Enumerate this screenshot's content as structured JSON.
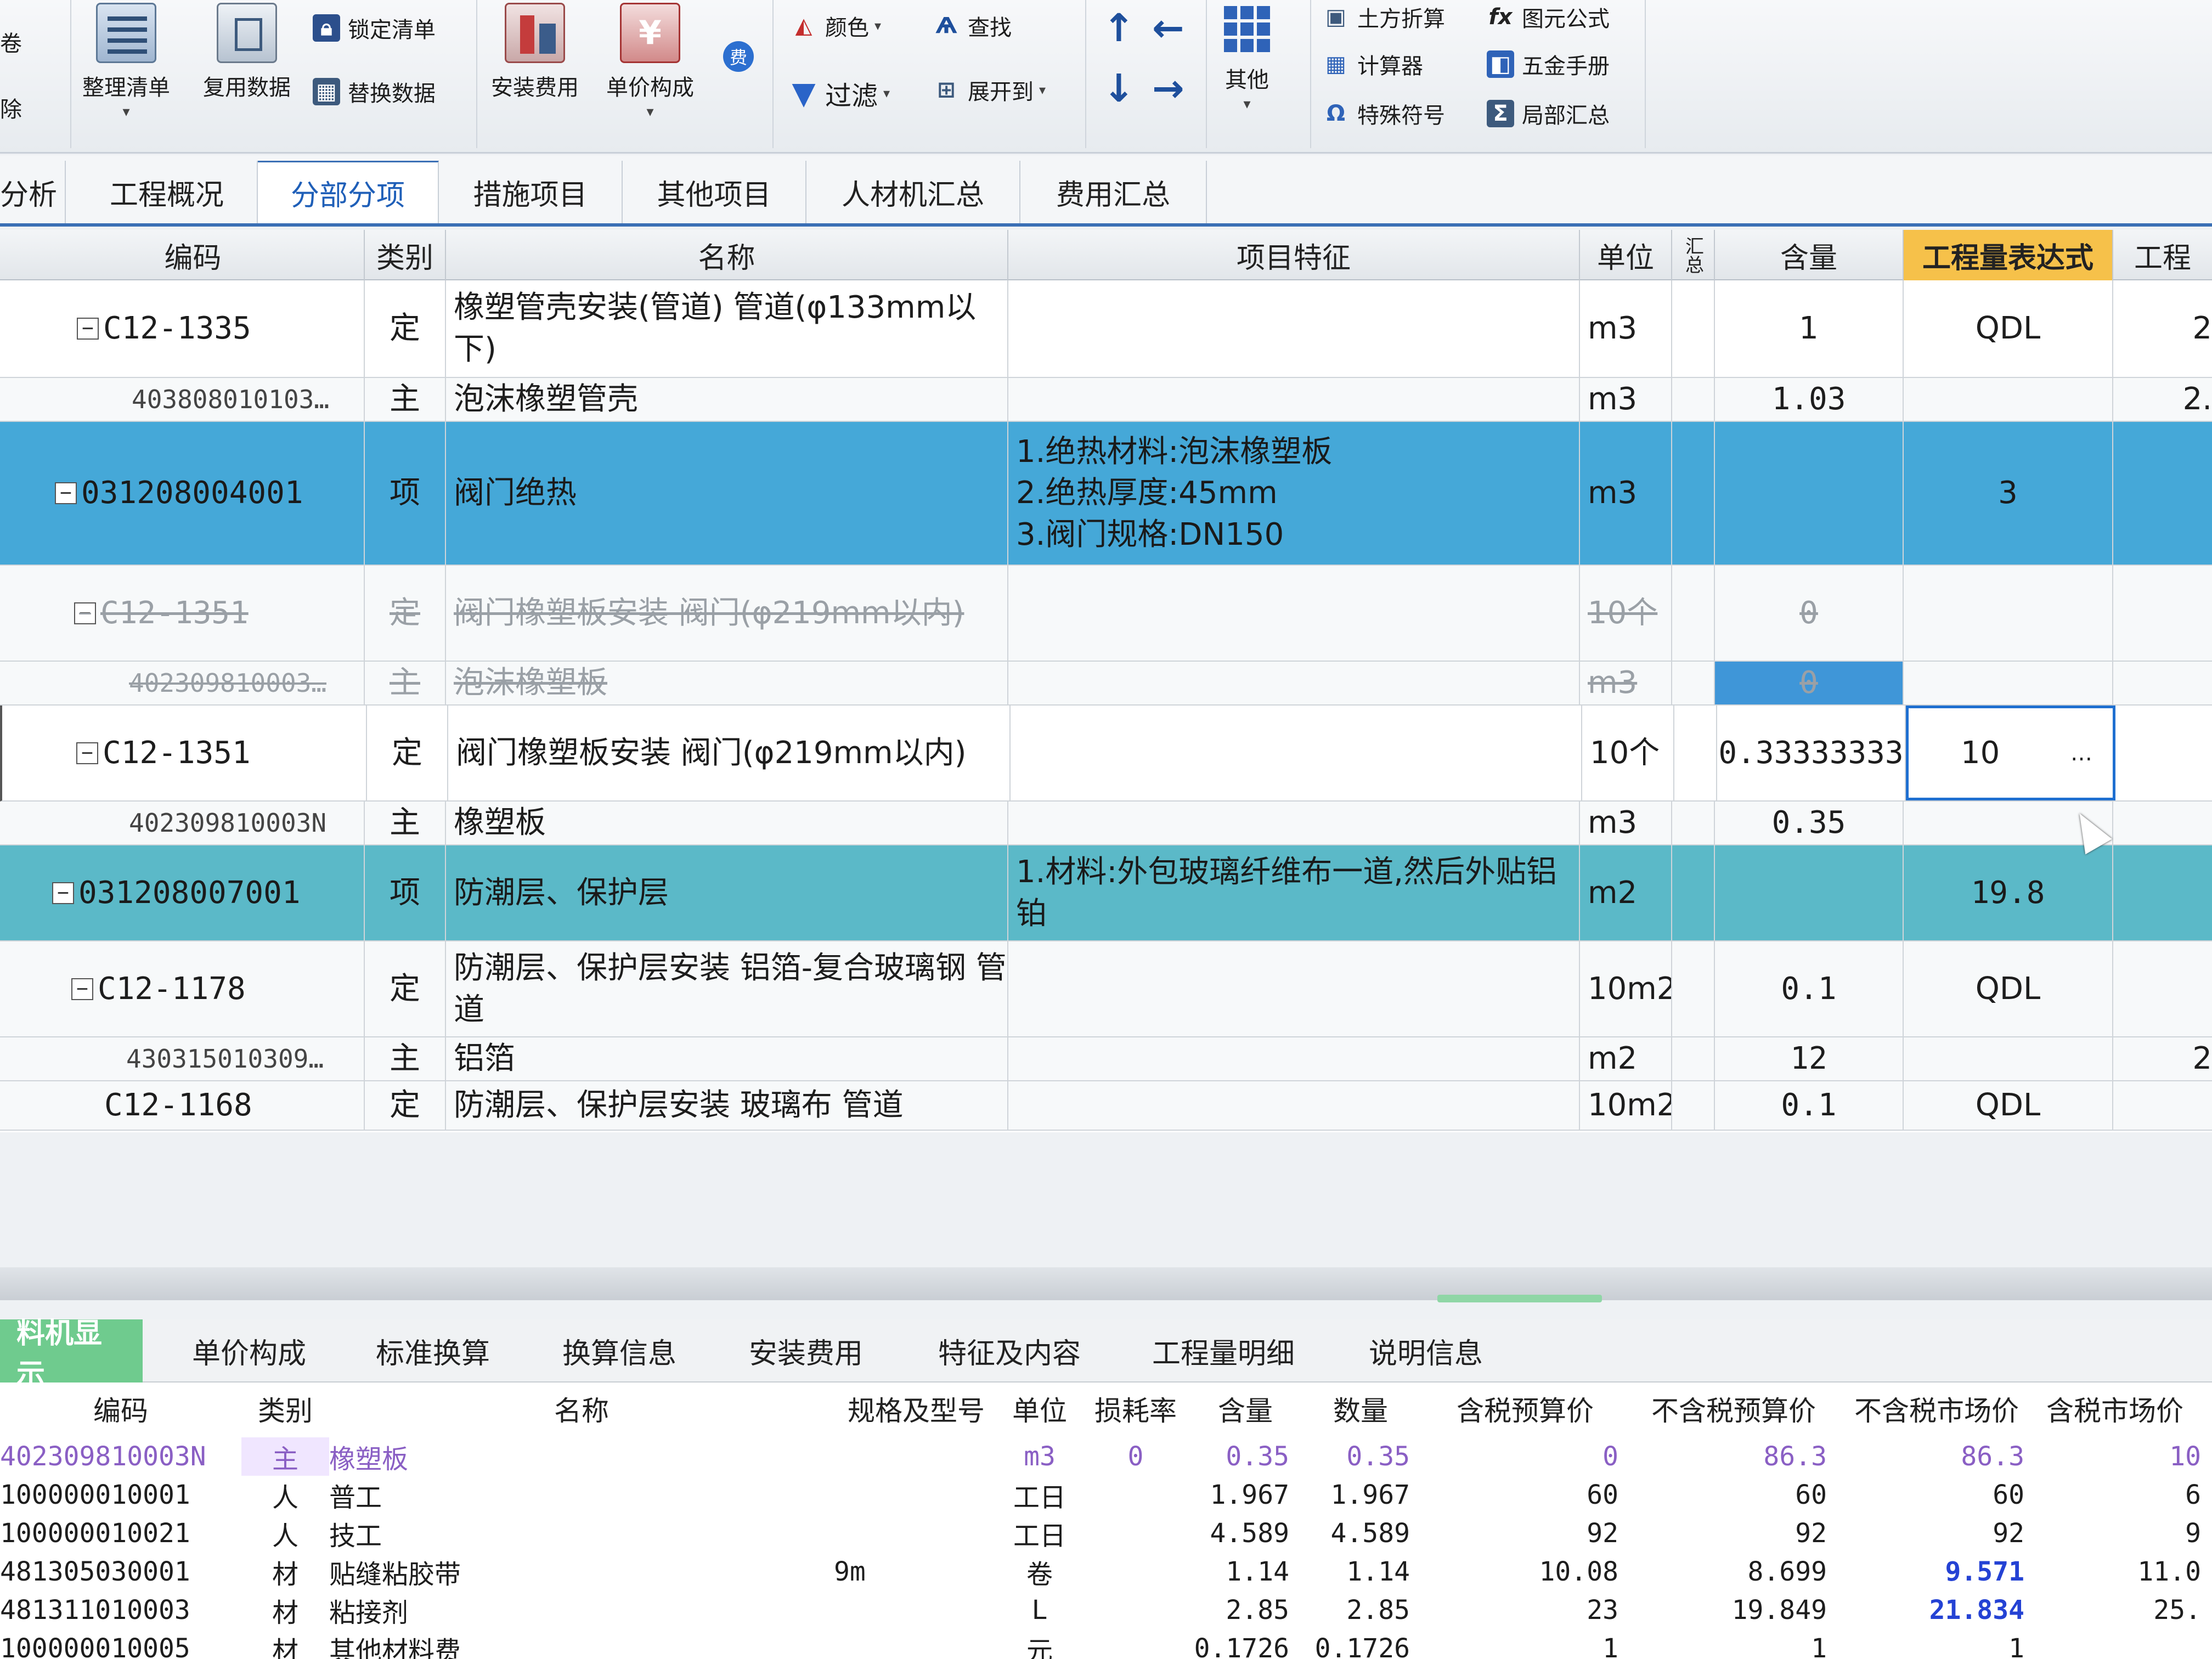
{
  "ribbon": {
    "left_cut": [
      "卷",
      "除"
    ],
    "big": [
      {
        "label": "整理清单",
        "icon": "list-organize-icon"
      },
      {
        "label": "复用数据",
        "icon": "reuse-data-icon"
      },
      {
        "label": "安装费用",
        "icon": "install-cost-icon"
      },
      {
        "label": "单价构成",
        "icon": "unit-price-icon"
      },
      {
        "label": "其他",
        "icon": "grid-more-icon"
      }
    ],
    "small": {
      "lock": "锁定清单",
      "replace": "替换数据",
      "color": "颜色",
      "find": "查找",
      "filter": "过滤",
      "expand": "展开到",
      "earthwork": "土方折算",
      "calculator": "计算器",
      "special": "特殊符号",
      "formula": "图元公式",
      "hardware": "五金手册",
      "partial": "局部汇总"
    },
    "fee_badge": "费"
  },
  "tabs": [
    "分析",
    "工程概况",
    "分部分项",
    "措施项目",
    "其他项目",
    "人材机汇总",
    "费用汇总"
  ],
  "active_tab": "分部分项",
  "grid": {
    "headers": [
      "编码",
      "类别",
      "名称",
      "项目特征",
      "单位",
      "汇总",
      "含量",
      "工程量表达式",
      "工程"
    ],
    "rows": [
      {
        "code": "C12-1335",
        "type": "定",
        "name": "橡塑管壳安装(管道) 管道(φ133mm以下)",
        "feature": "",
        "unit": "m3",
        "content": "1",
        "expr": "QDL",
        "extra": "2"
      },
      {
        "code": "403808010103…",
        "type": "主",
        "name": "泡沫橡塑管壳",
        "feature": "",
        "unit": "m3",
        "content": "1.03",
        "expr": "",
        "extra": "2."
      },
      {
        "code": "031208004001",
        "type": "项",
        "name": "阀门绝热",
        "feature": "1.绝热材料:泡沫橡塑板\n2.绝热厚度:45mm\n3.阀门规格:DN150",
        "unit": "m3",
        "content": "",
        "expr": "3",
        "extra": ""
      },
      {
        "code": "C12-1351",
        "type": "定",
        "name": "阀门橡塑板安装 阀门(φ219mm以内)",
        "feature": "",
        "unit": "10个",
        "content": "0",
        "expr": "",
        "extra": ""
      },
      {
        "code": "402309810003…",
        "type": "主",
        "name": "泡沫橡塑板",
        "feature": "",
        "unit": "m3",
        "content": "0",
        "expr": "",
        "extra": ""
      },
      {
        "code": "C12-1351",
        "type": "定",
        "name": "阀门橡塑板安装 阀门(φ219mm以内)",
        "feature": "",
        "unit": "10个",
        "content": "0.33333333",
        "expr": "10",
        "extra": ""
      },
      {
        "code": "402309810003N",
        "type": "主",
        "name": "橡塑板",
        "feature": "",
        "unit": "m3",
        "content": "0.35",
        "expr": "",
        "extra": ""
      },
      {
        "code": "031208007001",
        "type": "项",
        "name": "防潮层、保护层",
        "feature": "1.材料:外包玻璃纤维布一道,然后外贴铝铂",
        "unit": "m2",
        "content": "",
        "expr": "19.8",
        "extra": ""
      },
      {
        "code": "C12-1178",
        "type": "定",
        "name": "防潮层、保护层安装 铝箔-复合玻璃钢 管道",
        "feature": "",
        "unit": "10m2",
        "content": "0.1",
        "expr": "QDL",
        "extra": ""
      },
      {
        "code": "430315010309…",
        "type": "主",
        "name": "铝箔",
        "feature": "",
        "unit": "m2",
        "content": "12",
        "expr": "",
        "extra": "2"
      },
      {
        "code": "C12-1168",
        "type": "定",
        "name": "防潮层、保护层安装 玻璃布 管道",
        "feature": "",
        "unit": "10m2",
        "content": "0.1",
        "expr": "QDL",
        "extra": ""
      }
    ],
    "ellipsis": "…"
  },
  "bottom": {
    "tabs": [
      "料机显示",
      "单价构成",
      "标准换算",
      "换算信息",
      "安装费用",
      "特征及内容",
      "工程量明细",
      "说明信息"
    ],
    "headers": [
      "编码",
      "类别",
      "名称",
      "规格及型号",
      "单位",
      "损耗率",
      "含量",
      "数量",
      "含税预算价",
      "不含税预算价",
      "不含税市场价",
      "含税市场价"
    ],
    "rows": [
      {
        "code": "402309810003N",
        "type": "主",
        "name": "橡塑板",
        "spec": "",
        "unit": "m3",
        "loss": "0",
        "content": "0.35",
        "qty": "0.35",
        "tax_budget": "0",
        "notax_budget": "86.3",
        "notax_market": "86.3",
        "tax_market": "10"
      },
      {
        "code": "100000010001",
        "type": "人",
        "name": "普工",
        "spec": "",
        "unit": "工日",
        "loss": "",
        "content": "1.967",
        "qty": "1.967",
        "tax_budget": "60",
        "notax_budget": "60",
        "notax_market": "60",
        "tax_market": "6"
      },
      {
        "code": "100000010021",
        "type": "人",
        "name": "技工",
        "spec": "",
        "unit": "工日",
        "loss": "",
        "content": "4.589",
        "qty": "4.589",
        "tax_budget": "92",
        "notax_budget": "92",
        "notax_market": "92",
        "tax_market": "9"
      },
      {
        "code": "481305030001",
        "type": "材",
        "name": "贴缝粘胶带",
        "spec": "9m",
        "unit": "卷",
        "loss": "",
        "content": "1.14",
        "qty": "1.14",
        "tax_budget": "10.08",
        "notax_budget": "8.699",
        "notax_market": "9.571",
        "tax_market": "11.0"
      },
      {
        "code": "481311010003",
        "type": "材",
        "name": "粘接剂",
        "spec": "",
        "unit": "L",
        "loss": "",
        "content": "2.85",
        "qty": "2.85",
        "tax_budget": "23",
        "notax_budget": "19.849",
        "notax_market": "21.834",
        "tax_market": "25."
      },
      {
        "code": "100000010005",
        "type": "材",
        "name": "其他材料费",
        "spec": "",
        "unit": "元",
        "loss": "",
        "content": "0.1726",
        "qty": "0.1726",
        "tax_budget": "1",
        "notax_budget": "1",
        "notax_market": "1",
        "tax_market": ""
      }
    ]
  },
  "colors": {
    "selected_row": "#45a8d8",
    "selected_row2": "#5bb9c8",
    "highlight_header": "#f6c14a",
    "active_bottom_tab": "#6fcb8e",
    "tab_accent": "#3a6fb5"
  }
}
